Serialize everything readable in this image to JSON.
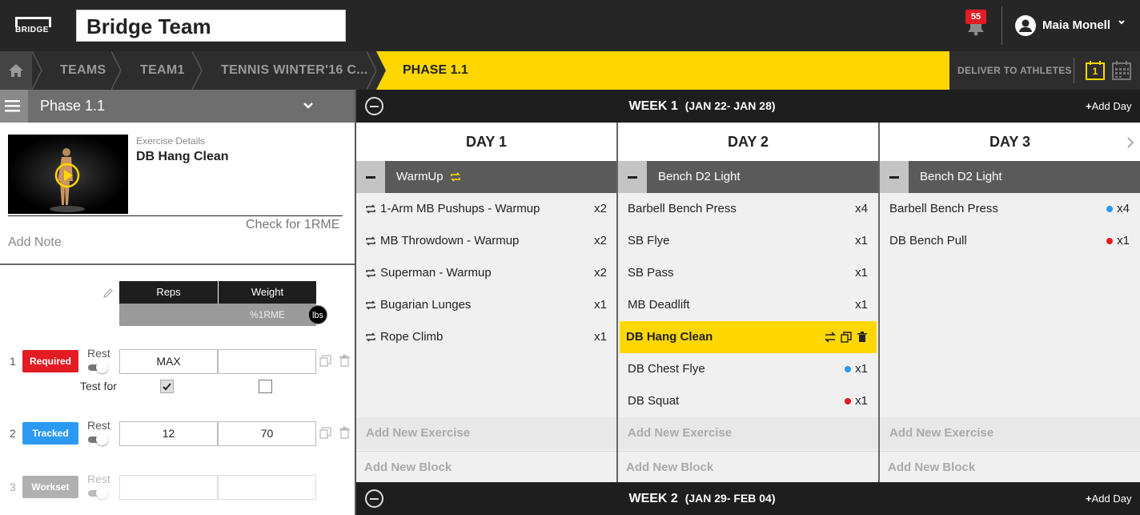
{
  "app": {
    "logo_text": "BRIDGE",
    "team_name": "Bridge Team"
  },
  "notifications": {
    "count": "55"
  },
  "user": {
    "name": "Maia Monell"
  },
  "breadcrumb": {
    "items": [
      "TEAMS",
      "TEAM1",
      "TENNIS WINTER'16 C...",
      "PHASE 1.1"
    ],
    "deliver_label": "DELIVER TO ATHLETES",
    "calendar_day": "1"
  },
  "panel": {
    "title": "Phase 1.1",
    "exercise_details_label": "Exercise Details",
    "exercise_name": "DB Hang Clean",
    "check_1rme": "Check for 1RME",
    "add_note": "Add Note",
    "table": {
      "reps_header": "Reps",
      "weight_header": "Weight",
      "weight_sub": "%1RME",
      "unit": "lbs"
    },
    "test_for_label": "Test for",
    "sets": [
      {
        "num": "1",
        "tag": "Required",
        "tag_color": "#e31b23",
        "rest": "Rest",
        "reps": "MAX",
        "weight": ""
      },
      {
        "num": "2",
        "tag": "Tracked",
        "tag_color": "#2b9af3",
        "rest": "Rest",
        "reps": "12",
        "weight": "70"
      },
      {
        "num": "3",
        "tag": "Workset",
        "tag_color": "#b0b0b0",
        "rest": "Rest",
        "reps": "",
        "weight": ""
      }
    ]
  },
  "weeks": [
    {
      "label": "WEEK 1",
      "range": "(JAN 22- JAN 28)",
      "add_day": "Add Day"
    },
    {
      "label": "WEEK 2",
      "range": "(JAN 29- FEB 04)",
      "add_day": "Add Day"
    }
  ],
  "days": [
    {
      "title": "DAY 1",
      "block": "WarmUp",
      "exercises": [
        {
          "name": "1-Arm MB Pushups - Warmup",
          "count": "x2"
        },
        {
          "name": "MB Throwdown - Warmup",
          "count": "x2"
        },
        {
          "name": "Superman - Warmup",
          "count": "x2"
        },
        {
          "name": "Bugarian Lunges",
          "count": "x1"
        },
        {
          "name": "Rope Climb",
          "count": "x1"
        }
      ],
      "add_exercise": "Add New Exercise",
      "add_block": "Add New Block"
    },
    {
      "title": "DAY 2",
      "block": "Bench D2 Light",
      "exercises": [
        {
          "name": "Barbell Bench Press",
          "count": "x4"
        },
        {
          "name": "SB Flye",
          "count": "x1"
        },
        {
          "name": "SB Pass",
          "count": "x1"
        },
        {
          "name": "MB Deadlift",
          "count": "x1"
        },
        {
          "name": "DB Hang Clean",
          "count": ""
        },
        {
          "name": "DB Chest Flye",
          "count": "x1"
        },
        {
          "name": "DB Squat",
          "count": "x1"
        }
      ],
      "add_exercise": "Add New Exercise",
      "add_block": "Add New Block"
    },
    {
      "title": "DAY 3",
      "block": "Bench D2 Light",
      "exercises": [
        {
          "name": "Barbell Bench Press",
          "count": "x4"
        },
        {
          "name": "DB Bench Pull",
          "count": "x1"
        }
      ],
      "add_exercise": "Add New Exercise",
      "add_block": "Add New Block"
    }
  ],
  "colors": {
    "accent": "#ffd700",
    "required": "#e31b23",
    "tracked": "#2b9af3",
    "dark": "#262626"
  },
  "icons": [
    "home-icon",
    "bell-icon",
    "user-icon",
    "chevron-down-icon",
    "menu-icon",
    "play-icon",
    "pencil-icon",
    "copy-icon",
    "trash-icon",
    "swap-icon",
    "repeat-icon",
    "calendar-icon",
    "plus-icon",
    "chevron-right-icon"
  ]
}
